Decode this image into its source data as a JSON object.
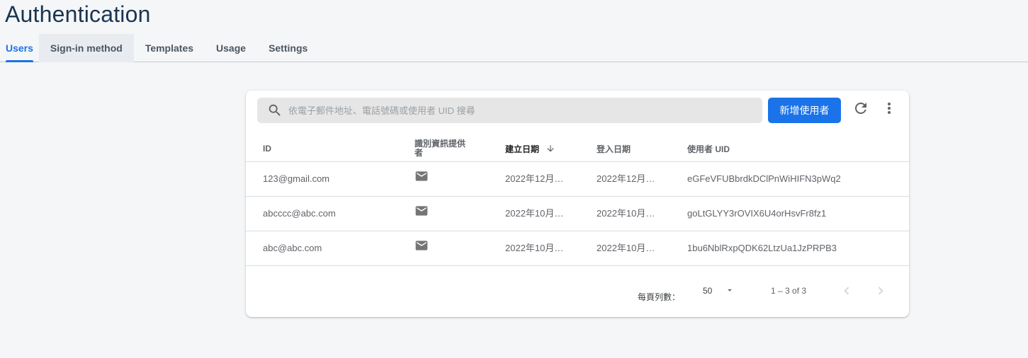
{
  "header": {
    "title": "Authentication",
    "tabs": [
      {
        "label": "Users"
      },
      {
        "label": "Sign-in method"
      },
      {
        "label": "Templates"
      },
      {
        "label": "Usage"
      },
      {
        "label": "Settings"
      }
    ]
  },
  "toolbar": {
    "search_placeholder": "依電子郵件地址、電話號碼或使用者 UID 搜尋",
    "search_icon": "search-icon",
    "add_user_label": "新增使用者",
    "refresh_icon": "refresh-icon",
    "more_icon": "more-vert-icon",
    "accent_color": "#1a73e8"
  },
  "table": {
    "columns": {
      "id": "ID",
      "provider": "識別資訊提供者",
      "created": "建立日期",
      "signed_in": "登入日期",
      "uid": "使用者 UID"
    },
    "sort_icon": "arrow-down-icon",
    "rows": [
      {
        "id": "123@gmail.com",
        "provider_icon": "email-icon",
        "created": "2022年12月…",
        "signed_in": "2022年12月…",
        "uid": "eGFeVFUBbrdkDClPnWiHIFN3pWq2"
      },
      {
        "id": "abcccc@abc.com",
        "provider_icon": "email-icon",
        "created": "2022年10月…",
        "signed_in": "2022年10月…",
        "uid": "goLtGLYY3rOVIX6U4orHsvFr8fz1"
      },
      {
        "id": "abc@abc.com",
        "provider_icon": "email-icon",
        "created": "2022年10月…",
        "signed_in": "2022年10月…",
        "uid": "1bu6NblRxpQDK62LtzUa1JzPRPB3"
      }
    ]
  },
  "pagination": {
    "rows_per_page_label": "每頁列數：",
    "rows_per_page_value": "50",
    "range": "1 – 3 of 3",
    "prev_icon": "chevron-left-icon",
    "next_icon": "chevron-right-icon"
  }
}
